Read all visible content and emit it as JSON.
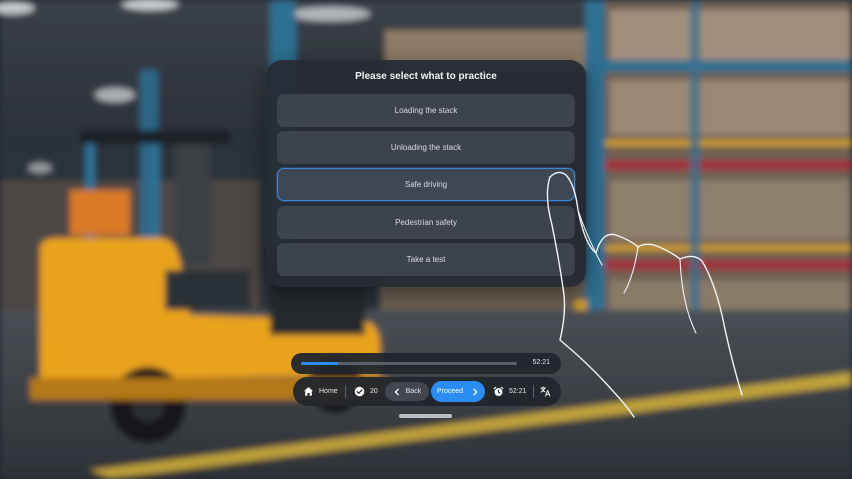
{
  "panel": {
    "title": "Please select what to practice",
    "options": [
      {
        "label": "Loading the stack",
        "selected": false
      },
      {
        "label": "Unloading the stack",
        "selected": false
      },
      {
        "label": "Safe driving",
        "selected": true
      },
      {
        "label": "Pedestrian safety",
        "selected": false
      },
      {
        "label": "Take a test",
        "selected": false
      }
    ]
  },
  "progress": {
    "fraction": 0.17,
    "time": "52:21"
  },
  "toolbar": {
    "home_label": "Home",
    "checks_count": "20",
    "back_label": "Back",
    "proceed_label": "Proceed",
    "timer": "52:21"
  },
  "icons": {
    "home": "home-icon",
    "check": "check-circle-icon",
    "back": "chevron-left-icon",
    "proceed": "chevron-right-icon",
    "timer": "alarm-clock-icon",
    "translate": "translate-icon"
  },
  "colors": {
    "accent": "#2b8cf2",
    "panel_bg": "#262b33",
    "selected_border": "#3f86d8",
    "forklift": "#e9a21b"
  }
}
